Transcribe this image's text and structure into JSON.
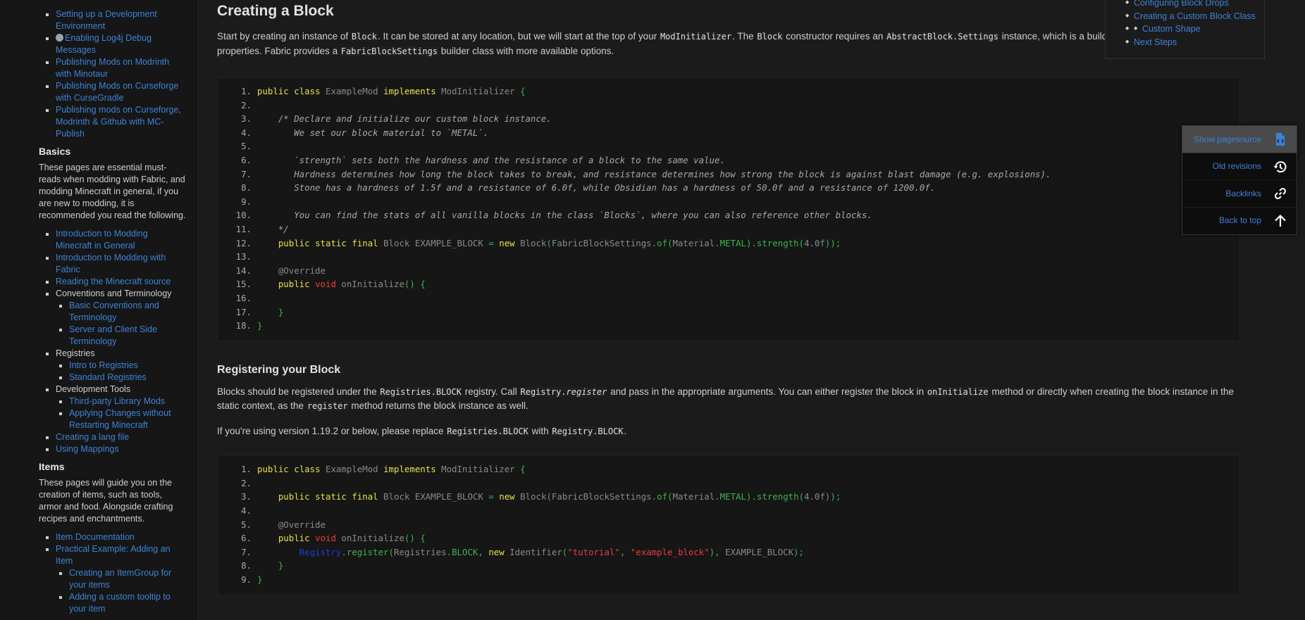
{
  "sidebar": {
    "top_links": [
      "Setting up a Development Environment",
      "Enabling Log4j Debug Messages",
      "Publishing Mods on Modrinth with Minotaur",
      "Publishing Mods on Curseforge with CurseGradle",
      "Publishing mods on Curseforge, Modrinth & Github with MC-Publish"
    ],
    "basics": {
      "title": "Basics",
      "desc": "These pages are essential must-reads when modding with Fabric, and modding Minecraft in general, if you are new to modding, it is recommended you read the following.",
      "link1": "Introduction to Modding Minecraft in General",
      "link2": "Introduction to Modding with Fabric",
      "link3": "Reading the Minecraft source",
      "conventions": "Conventions and Terminology",
      "conv_sub1": "Basic Conventions and Terminology",
      "conv_sub2": "Server and Client Side Terminology",
      "registries": "Registries",
      "reg_sub1": "Intro to Registries",
      "reg_sub2": "Standard Registries",
      "devtools": "Development Tools",
      "dev_sub1": "Third-party Library Mods",
      "dev_sub2": "Applying Changes without Restarting Minecraft",
      "link4": "Creating a lang file",
      "link5": "Using Mappings"
    },
    "items": {
      "title": "Items",
      "desc": "These pages will guide you on the creation of items, such as tools, armor and food. Alongside crafting recipes and enchantments.",
      "link1": "Item Documentation",
      "link2": "Practical Example: Adding an Item",
      "sub1": "Creating an ItemGroup for your items",
      "sub2": "Adding a custom tooltip to your item"
    }
  },
  "toc": {
    "item1": "Configuring Block Drops",
    "item2": "Creating a Custom Block Class",
    "item3": "Custom Shape",
    "item4": "Next Steps"
  },
  "pagetools": {
    "show_source": "Show pagesource",
    "old_revisions": "Old revisions",
    "backlinks": "Backlinks",
    "back_to_top": "Back to top"
  },
  "main": {
    "h1": "Creating a Block",
    "p1": {
      "a": "Start by creating an instance of ",
      "c1": "Block",
      "b": ". It can be stored at any location, but we will start at the top of your ",
      "c2": "ModInitializer",
      "c": ". The ",
      "c3": "Block",
      "d": " constructor requires an ",
      "c4": "AbstractBlock.Settings",
      "e": " instance, which is a builder for configuring block properties. Fabric provides a ",
      "c5": "FabricBlockSettings",
      "f": " builder class with more available options."
    },
    "code1": {
      "n1": "1.",
      "n2": "2.",
      "n3": "3.",
      "n4": "4.",
      "n5": "5.",
      "n6": "6.",
      "n7": "7.",
      "n8": "8.",
      "n9": "9.",
      "n10": "10.",
      "n11": "11.",
      "n12": "12.",
      "n13": "13.",
      "n14": "14.",
      "n15": "15.",
      "n16": "16.",
      "n17": "17.",
      "n18": "18.",
      "kw_public": "public",
      "kw_class": "class",
      "cls": "ExampleMod",
      "kw_implements": "implements",
      "iface": "ModInitializer",
      "brace_open": "{",
      "c3": "/* Declare and initialize our custom block instance.",
      "c4": "We set our block material to `METAL`.",
      "c6": "`strength` sets both the hardness and the resistance of a block to the same value.",
      "c7": "Hardness determines how long the block takes to break, and resistance determines how strong the block is against blast damage (e.g. explosions).",
      "c8": "Stone has a hardness of 1.5f and a resistance of 6.0f, while Obsidian has a hardness of 50.0f and a resistance of 1200.0f.",
      "c10": "You can find the stats of all vanilla blocks in the class `Blocks`, where you can also reference other blocks.",
      "c11": "*/",
      "static": "static",
      "final": "final",
      "block_type": "Block",
      "field": "EXAMPLE_BLOCK",
      "eq": "=",
      "kw_new": "new",
      "settings": "FabricBlockSettings",
      "of": "of",
      "material": "Material",
      "metal": "METAL",
      "strength": "strength",
      "num": "4.0f",
      "override": "@Override",
      "void": "void",
      "init": "onInitialize",
      "paren": "()",
      "close": "}"
    },
    "h2": "Registering your Block",
    "p2": {
      "a": "Blocks should be registered under the ",
      "c1": "Registries.BLOCK",
      "b": " registry. Call ",
      "c2a": "Registry.",
      "c2b": "register",
      "c": " and pass in the appropriate arguments. You can either register the block in ",
      "c3": "onInitialize",
      "d": " method or directly when creating the block instance in the static context, as the ",
      "c4": "register",
      "e": " method returns the block instance as well."
    },
    "p3": {
      "a": "If you're using version 1.19.2 or below, please replace ",
      "c1": "Registries.BLOCK",
      "b": " with ",
      "c2": "Registry.BLOCK",
      "c": "."
    },
    "code2": {
      "registry": "Registry",
      "register": "register",
      "registries": "Registries",
      "block": "BLOCK",
      "identifier": "Identifier",
      "s1": "\"tutorial\"",
      "s2": "\"example_block\""
    }
  }
}
